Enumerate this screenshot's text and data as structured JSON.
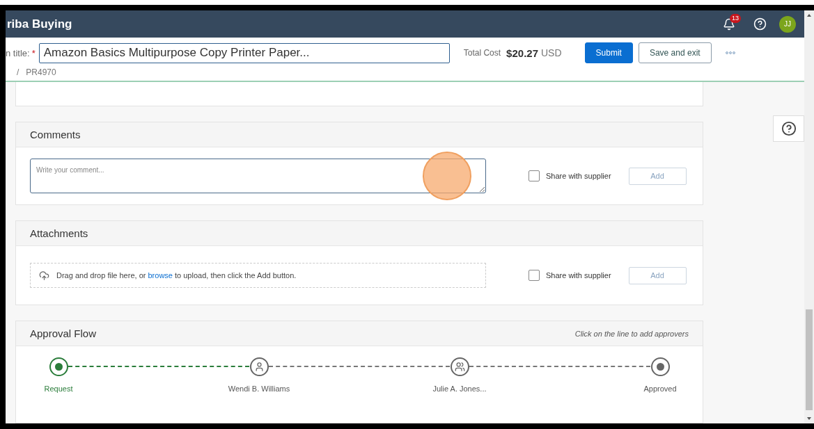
{
  "app": {
    "title": "riba Buying",
    "notification_count": "13",
    "avatar_initials": "JJ"
  },
  "request": {
    "title_label": "n title:",
    "required_mark": "*",
    "title_value": "Amazon Basics Multipurpose Copy Printer Paper...",
    "total_label": "Total Cost",
    "total_amount": "$20.27",
    "total_currency": "USD",
    "breadcrumb_separator": "/",
    "request_id": "PR4970",
    "buttons": [
      {
        "label": "Submit",
        "primary": true
      },
      {
        "label": "Save and exit",
        "primary": false
      }
    ]
  },
  "comments": {
    "title": "Comments",
    "placeholder": "Write your comment...",
    "share_label": "Share with supplier",
    "share_checked": false,
    "add_label": "Add",
    "add_disabled": true
  },
  "attachments": {
    "title": "Attachments",
    "drop_text_before": "Drag and drop file here, or",
    "browse_link": "browse",
    "drop_text_after": "to upload, then click the Add button.",
    "share_label": "Share with supplier",
    "share_checked": false,
    "add_label": "Add",
    "add_disabled": true
  },
  "approval_flow": {
    "title": "Approval Flow",
    "hint": "Click on the line to add approvers",
    "steps": [
      {
        "label": "Request",
        "kind": "start",
        "complete": true
      },
      {
        "label": "Wendi B. Williams",
        "kind": "approver",
        "complete": false
      },
      {
        "label": "Julie A. Jones...",
        "kind": "group",
        "complete": false
      },
      {
        "label": "Approved",
        "kind": "end",
        "complete": false
      }
    ]
  }
}
